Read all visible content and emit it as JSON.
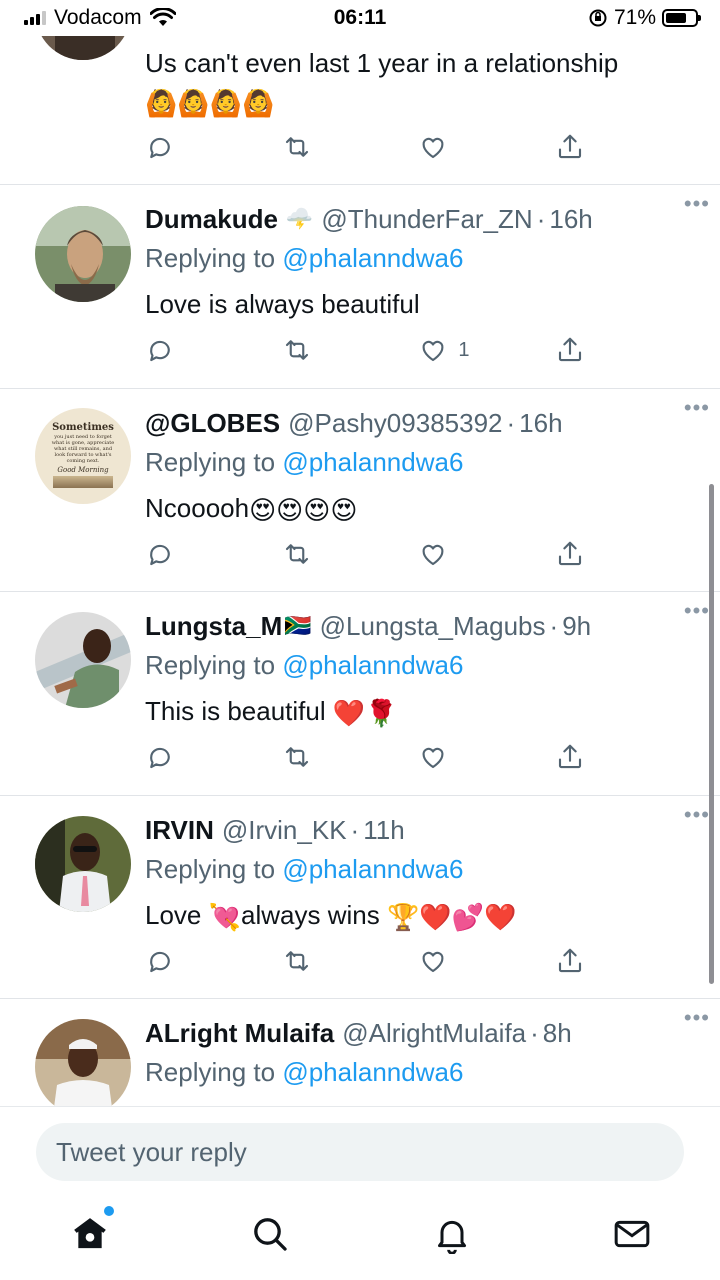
{
  "status_bar": {
    "carrier": "Vodacom",
    "time": "06:11",
    "battery_percent": "71%",
    "battery_level": 0.71
  },
  "tweets": [
    {
      "name": "",
      "handle": "",
      "time": "",
      "replying_to_prefix": "",
      "replying_to_mention": "",
      "text": "Us can't even last 1 year in a relationship",
      "text_emoji": "🙆🙆🙆🙆",
      "like_count": ""
    },
    {
      "name": "Dumakude",
      "name_emoji": "🌩️",
      "handle": "@ThunderFar_ZN",
      "time": "16h",
      "replying_to_prefix": "Replying to ",
      "replying_to_mention": "@phalanndwa6",
      "text": "Love is always beautiful",
      "like_count": "1"
    },
    {
      "name": "@GLOBES",
      "handle": "@Pashy09385392",
      "time": "16h",
      "replying_to_prefix": "Replying to ",
      "replying_to_mention": "@phalanndwa6",
      "text": "Ncooooh",
      "text_emoji": "😍😍😍😍",
      "like_count": "",
      "avatar_text": {
        "title": "Sometimes",
        "body": "you just need to forget what is gone, appreciate what still remains, and look forward to what's coming next.",
        "footer": "Good Morning"
      }
    },
    {
      "name": "Lungsta_M",
      "name_emoji": "🇿🇦",
      "handle": "@Lungsta_Magubs",
      "time": "9h",
      "replying_to_prefix": "Replying to ",
      "replying_to_mention": "@phalanndwa6",
      "text": "This is beautiful",
      "text_emoji": "❤️🌹",
      "like_count": ""
    },
    {
      "name": "IRVIN",
      "handle": "@Irvin_KK",
      "time": "11h",
      "replying_to_prefix": "Replying to ",
      "replying_to_mention": "@phalanndwa6",
      "text_a": "Love",
      "text_emoji_a": "💘",
      "text_b": "always wins",
      "text_emoji_b": "🏆❤️💕❤️",
      "like_count": ""
    },
    {
      "name": "ALright Mulaifa",
      "handle": "@AlrightMulaifa",
      "time": "8h",
      "replying_to_prefix": "Replying to ",
      "replying_to_mention": "@phalanndwa6",
      "text": "",
      "like_count": ""
    }
  ],
  "reply_bar": {
    "placeholder": "Tweet your reply"
  },
  "tab_bar": {
    "items": [
      "home-icon",
      "search-icon",
      "notifications-icon",
      "messages-icon"
    ]
  },
  "colors": {
    "accent": "#1d9bf0",
    "secondary_text": "#536471",
    "primary_text": "#0f1419",
    "divider": "#e1e4e8"
  }
}
